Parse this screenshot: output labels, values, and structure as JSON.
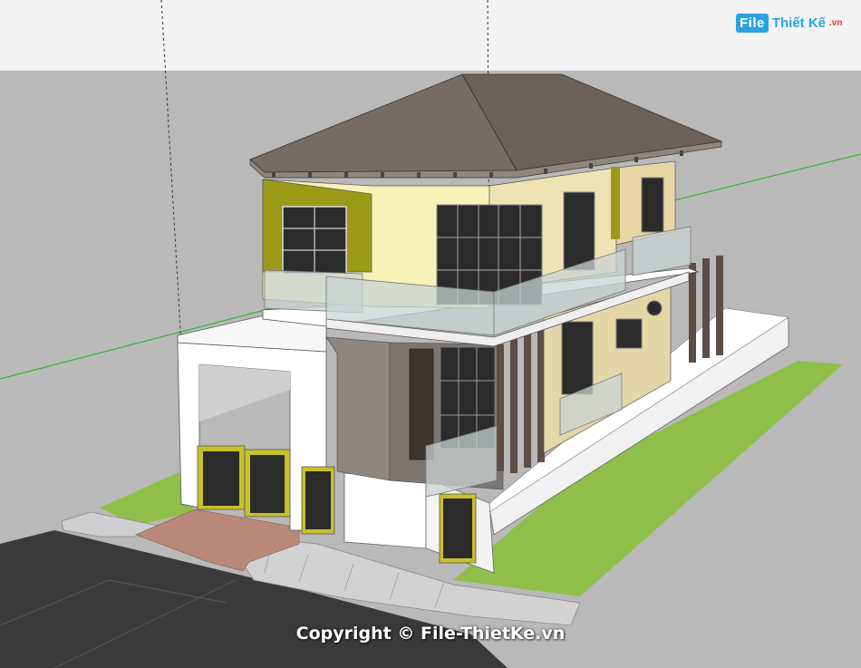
{
  "watermark_logo": {
    "box_text": "File",
    "text": "Thiết Kế",
    "suffix": ".vn"
  },
  "copyright_text": "Copyright © File-ThietKe.vn",
  "colors": {
    "sky": "#f3f3f3",
    "ground": "#b9b9b9",
    "lawn": "#8fbf4a",
    "road": "#3a3a3a",
    "roof": "#6e675f",
    "wall_cream": "#efe3b4",
    "wall_yellow": "#f6f2b8",
    "accent_olive": "#9a9a18",
    "glass": "#c9d3d3",
    "axis_green": "#2db52d",
    "logo_blue": "#2aa3e0"
  }
}
